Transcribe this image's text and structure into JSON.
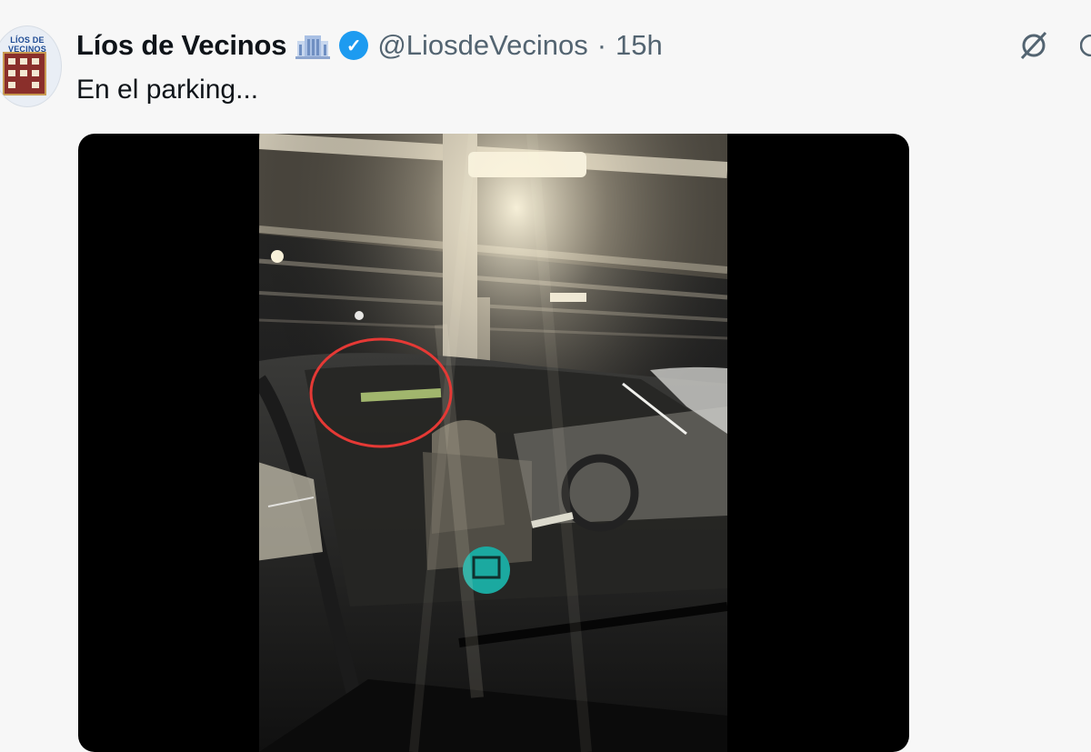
{
  "tweet": {
    "author_name": "Líos de Vecinos",
    "handle": "@LiosdeVecinos",
    "separator": "·",
    "time": "15h",
    "text": "En el parking...",
    "avatar_text": "LÍOS DE VECINOS"
  },
  "icons": {
    "verified": "verified-badge-icon",
    "building": "building-emoji-icon",
    "grok": "grok-icon",
    "more": "more-icon"
  },
  "colors": {
    "verified": "#1d9bf0",
    "annotation_circle": "#e53935",
    "sticker": "#1ba9a0"
  }
}
